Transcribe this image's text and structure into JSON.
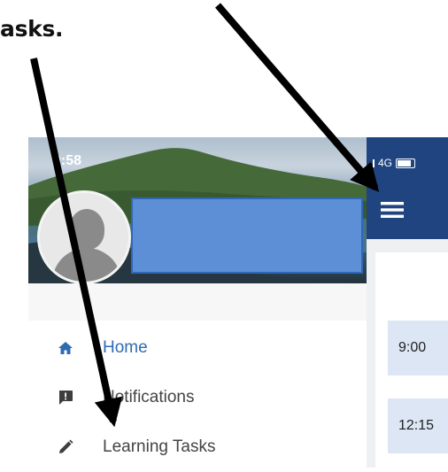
{
  "caption": "asks.",
  "status": {
    "time": "9:58",
    "network": "4G"
  },
  "drawer": {
    "items": [
      {
        "label": "Home",
        "icon": "home-icon",
        "active": true
      },
      {
        "label": "Notifications",
        "icon": "notification-icon",
        "active": false
      },
      {
        "label": "Learning Tasks",
        "icon": "pencil-icon",
        "active": false
      }
    ]
  },
  "app": {
    "slots": [
      "9:00",
      "12:15"
    ]
  },
  "colors": {
    "app_bar": "#1f4480",
    "accent": "#2f6bb3",
    "redaction": "#5c8fd6",
    "slot_bg": "#dce6f5"
  }
}
